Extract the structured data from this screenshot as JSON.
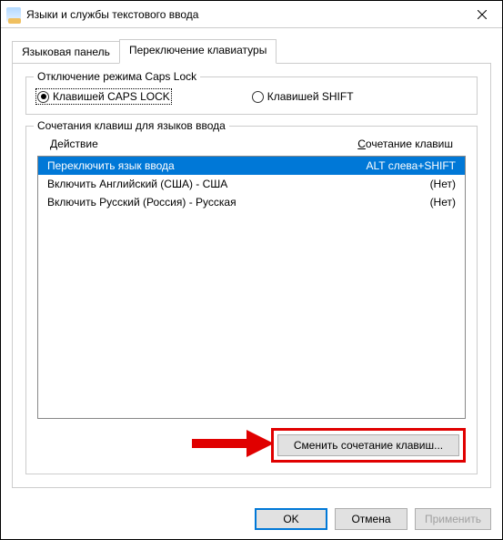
{
  "window": {
    "title": "Языки и службы текстового ввода"
  },
  "tabs": {
    "tab1": "Языковая панель",
    "tab2": "Переключение клавиатуры"
  },
  "capslock_group": {
    "title": "Отключение режима Caps Lock",
    "opt1": "Клавишей CAPS LOCK",
    "opt2": "Клавишей SHIFT"
  },
  "hotkey_group": {
    "title": "Сочетания клавиш для языков ввода",
    "col_action_prefix": "Д",
    "col_action_rest": "ействие",
    "col_hotkey_prefix": "С",
    "col_hotkey_rest": "очетание клавиш",
    "rows": [
      {
        "action": "Переключить язык ввода",
        "hotkey": "ALT слева+SHIFT"
      },
      {
        "action": "Включить Английский (США) - США",
        "hotkey": "(Нет)"
      },
      {
        "action": "Включить Русский (Россия) - Русская",
        "hotkey": "(Нет)"
      }
    ],
    "change_button": "Сменить сочетание клавиш..."
  },
  "buttons": {
    "ok": "OK",
    "cancel": "Отмена",
    "apply": "Применить"
  }
}
